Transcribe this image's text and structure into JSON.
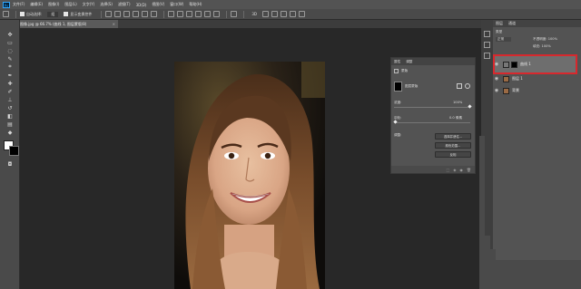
{
  "app": {
    "logo_text": "Ps"
  },
  "menubar": {
    "items": [
      "文件(F)",
      "编辑(E)",
      "图像(I)",
      "图层(L)",
      "文字(Y)",
      "选择(S)",
      "滤镜(T)",
      "3D(D)",
      "视图(V)",
      "窗口(W)",
      "帮助(H)"
    ]
  },
  "options": {
    "auto_select_label": "自动选择:",
    "auto_select_value": "组",
    "transform_label": "显示变换控件"
  },
  "document_tab": {
    "title": "图像.jpg @ 66.7% (曲线 1, 图层蒙版/8)",
    "close": "×"
  },
  "properties_panel": {
    "tabs": [
      "属性",
      "调整"
    ],
    "section_label": "蒙版",
    "mask_name": "图层蒙版",
    "density_label": "浓度:",
    "density_value": "100%",
    "feather_label": "羽化:",
    "feather_value": "0.0 像素",
    "refine_label": "调整:",
    "btn_select_mask": "选择并遮住...",
    "btn_color_range": "颜色范围...",
    "btn_invert": "反相"
  },
  "layers_panel": {
    "tabs": [
      "图层",
      "通道"
    ],
    "filter_label": "类型",
    "blend_mode": "正常",
    "opacity_label": "不透明度: 100%",
    "fill_label": "填充: 100%",
    "layers": [
      {
        "name": "曲线 1",
        "type": "adjustment",
        "selected": true
      },
      {
        "name": "图层 1",
        "type": "image",
        "selected": false
      },
      {
        "name": "背景",
        "type": "image",
        "selected": false
      }
    ]
  },
  "tools": [
    "move",
    "marquee",
    "lasso",
    "quick-select",
    "crop",
    "eyedropper",
    "healing",
    "brush",
    "stamp",
    "history-brush",
    "eraser",
    "gradient",
    "blur",
    "dodge",
    "pen",
    "type",
    "path-select",
    "shape",
    "hand",
    "zoom"
  ],
  "colors": {
    "highlight_box": "#d8282d",
    "foreground": "#ffffff",
    "background": "#000000"
  }
}
